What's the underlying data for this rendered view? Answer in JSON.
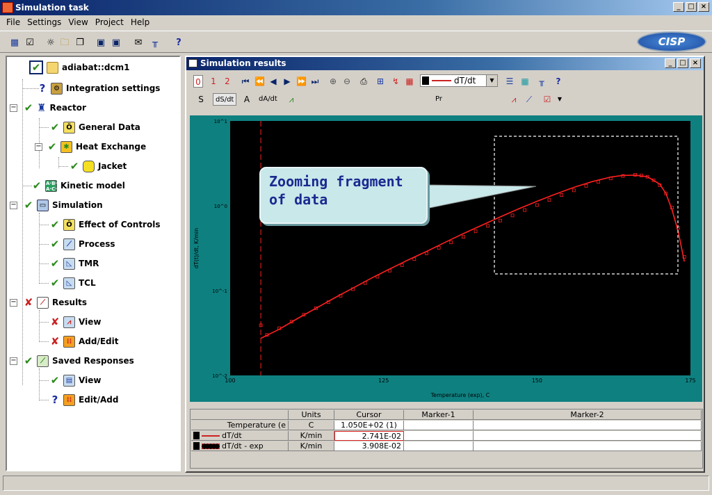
{
  "app": {
    "title": "Simulation task",
    "logo_text": "CISP"
  },
  "menu": [
    "File",
    "Settings",
    "View",
    "Project",
    "Help"
  ],
  "tree": {
    "items": [
      {
        "label": "adiabat::dcm1",
        "status": "check-box"
      },
      {
        "label": "Integration settings",
        "status": "question"
      },
      {
        "label": "Reactor",
        "status": "check"
      },
      {
        "label": "General Data",
        "status": "check"
      },
      {
        "label": "Heat Exchange",
        "status": "check"
      },
      {
        "label": "Jacket",
        "status": "check"
      },
      {
        "label": "Kinetic model",
        "status": "check"
      },
      {
        "label": "Simulation",
        "status": "check"
      },
      {
        "label": "Effect of Controls",
        "status": "check"
      },
      {
        "label": "Process",
        "status": "check"
      },
      {
        "label": "TMR",
        "status": "check"
      },
      {
        "label": "TCL",
        "status": "check"
      },
      {
        "label": "Results",
        "status": "cross"
      },
      {
        "label": "View",
        "status": "cross"
      },
      {
        "label": "Add/Edit",
        "status": "cross"
      },
      {
        "label": "Saved Responses",
        "status": "check"
      },
      {
        "label": "View",
        "status": "check"
      },
      {
        "label": "Edit/Add",
        "status": "question"
      }
    ]
  },
  "results": {
    "title": "Simulation results",
    "buttons_row1": [
      "0",
      "1",
      "2"
    ],
    "series_select": "dT/dt",
    "tabs": [
      "S",
      "dS/dt",
      "A",
      "dA/dt"
    ],
    "pr_label": "Pr",
    "callout": "Zooming fragment\nof data"
  },
  "chart_data": {
    "type": "line",
    "xlabel": "Temperature (exp), C",
    "ylabel": "dT(t)/dt, K/min",
    "xlim": [
      100,
      175
    ],
    "ylim_log10": [
      -2,
      1
    ],
    "x_ticks": [
      "100",
      "125",
      "150",
      "175"
    ],
    "y_ticks": [
      "10^-2",
      "10^-1",
      "10^0",
      "10^1"
    ],
    "cursor_x": 105,
    "series": [
      {
        "name": "dT/dt",
        "style": "line",
        "color": "#ff2020",
        "x": [
          105,
          108,
          111,
          114,
          117,
          120,
          123,
          126,
          129,
          132,
          135,
          138,
          141,
          144,
          147,
          150,
          153,
          156,
          159,
          162,
          164,
          166,
          168,
          170,
          171,
          172,
          173,
          173.5,
          174
        ],
        "y": [
          0.0274,
          0.035,
          0.047,
          0.062,
          0.082,
          0.107,
          0.14,
          0.18,
          0.23,
          0.29,
          0.37,
          0.47,
          0.59,
          0.74,
          0.92,
          1.13,
          1.37,
          1.65,
          1.93,
          2.18,
          2.28,
          2.3,
          2.2,
          1.8,
          1.4,
          0.9,
          0.5,
          0.33,
          0.22
        ]
      },
      {
        "name": "dT/dt - exp",
        "style": "squares",
        "color": "#ff2020",
        "x": [
          105,
          106,
          108,
          110,
          112,
          114,
          116,
          118,
          120,
          122,
          124,
          126,
          128,
          130,
          132,
          134,
          136,
          138,
          140,
          142,
          144,
          146,
          148,
          150,
          152,
          154,
          156,
          158,
          160,
          162,
          164,
          166,
          167,
          168,
          169,
          170,
          171,
          172,
          173,
          174
        ],
        "y": [
          0.039,
          0.03,
          0.036,
          0.043,
          0.052,
          0.062,
          0.073,
          0.087,
          0.104,
          0.123,
          0.146,
          0.172,
          0.2,
          0.235,
          0.275,
          0.32,
          0.37,
          0.43,
          0.5,
          0.58,
          0.67,
          0.77,
          0.89,
          1.02,
          1.17,
          1.34,
          1.52,
          1.72,
          1.92,
          2.1,
          2.25,
          2.32,
          2.28,
          2.2,
          2.0,
          1.75,
          1.4,
          0.95,
          0.55,
          0.25
        ]
      }
    ]
  },
  "table": {
    "headers": [
      "",
      "Units",
      "Cursor",
      "Marker-1",
      "Marker-2"
    ],
    "rows": [
      {
        "name": "Temperature (e",
        "units": "C",
        "cursor": "1.050E+02 (1)"
      },
      {
        "name": "dT/dt",
        "units": "K/min",
        "cursor": "2.741E-02"
      },
      {
        "name": "dT/dt - exp",
        "units": "K/min",
        "cursor": "3.908E-02"
      }
    ]
  }
}
